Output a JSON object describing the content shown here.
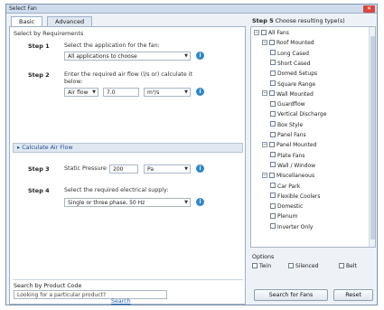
{
  "window": {
    "title": "Select Fan",
    "close_glyph": "✕"
  },
  "tabs": [
    {
      "label": "Basic"
    },
    {
      "label": "Advanced"
    }
  ],
  "left": {
    "section_title": "Select by Requirements",
    "step1": {
      "label": "Step 1",
      "description": "Select the application for the fan:",
      "select_value": "All applications to choose"
    },
    "step2": {
      "label": "Step 2",
      "description": "Enter the required air flow (l/s or) calculate it below:",
      "unit_select": "Air flow",
      "value": "7.0",
      "unit2_select": "m³/s"
    },
    "calculator": {
      "expand_glyph": "▸",
      "label": "Calculate Air Flow"
    },
    "step3": {
      "label": "Step 3",
      "description": "Static Pressure",
      "value": "200",
      "unit_select": "Pa"
    },
    "step4": {
      "label": "Step 4",
      "description": "Select the required electrical supply:",
      "select_value": "Single or three phase, 50 Hz"
    },
    "search": {
      "label": "Search by Product Code",
      "placeholder": "Looking for a particular product?",
      "link": "Search"
    }
  },
  "right": {
    "step5": {
      "label": "Step 5",
      "description": "Choose resulting type(s)"
    },
    "tree": [
      {
        "label": "All Fans",
        "level": 0,
        "expander": "−"
      },
      {
        "label": "Roof Mounted",
        "level": 1,
        "expander": "−"
      },
      {
        "label": "Long Cased",
        "level": 2
      },
      {
        "label": "Short Cased",
        "level": 2
      },
      {
        "label": "Domed Setups",
        "level": 2
      },
      {
        "label": "Square Range",
        "level": 2
      },
      {
        "label": "Wall Mounted",
        "level": 1,
        "expander": "−"
      },
      {
        "label": "Guardflow",
        "level": 2
      },
      {
        "label": "Vertical Discharge",
        "level": 2
      },
      {
        "label": "Box Style",
        "level": 2
      },
      {
        "label": "Panel Fans",
        "level": 2
      },
      {
        "label": "Panel Mounted",
        "level": 1,
        "expander": "−"
      },
      {
        "label": "Plate Fans",
        "level": 2
      },
      {
        "label": "Wall / Window",
        "level": 2
      },
      {
        "label": "Miscellaneous",
        "level": 1,
        "expander": "−"
      },
      {
        "label": "Car Park",
        "level": 2
      },
      {
        "label": "Flexible Coolers",
        "level": 2
      },
      {
        "label": "Domestic",
        "level": 2
      },
      {
        "label": "Plenum",
        "level": 2
      },
      {
        "label": "Inverter Only",
        "level": 2
      }
    ],
    "options": {
      "title": "Options",
      "items": [
        {
          "label": "Twin"
        },
        {
          "label": "Silenced"
        },
        {
          "label": "Belt"
        }
      ]
    },
    "buttons": {
      "search": "Search for Fans",
      "reset": "Reset"
    }
  },
  "icons": {
    "info": "i",
    "dropdown": "▼"
  },
  "colors": {
    "info": "#2f86c8",
    "close": "#d9463d",
    "titlebar": "#cfdced"
  }
}
